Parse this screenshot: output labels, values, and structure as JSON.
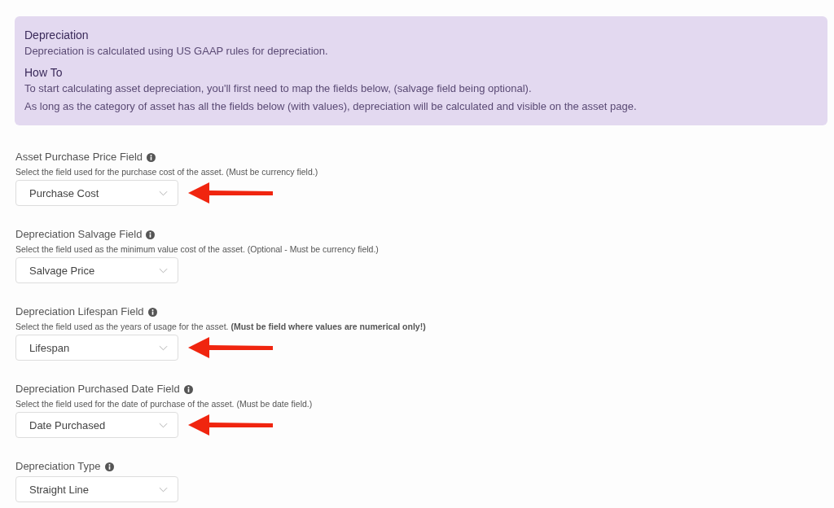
{
  "info_box": {
    "sections": [
      {
        "heading": "Depreciation",
        "lines": [
          "Depreciation is calculated using US GAAP rules for depreciation."
        ]
      },
      {
        "heading": "How To",
        "lines": [
          "To start calculating asset depreciation, you'll first need to map the fields below, (salvage field being optional).",
          "As long as the category of asset has all the fields below (with values), depreciation will be calculated and visible on the asset page."
        ]
      }
    ]
  },
  "fields": [
    {
      "label": "Asset Purchase Price Field",
      "hint": "Select the field used for the purchase cost of the asset. (Must be currency field.)",
      "value": "Purchase Cost",
      "arrow": true
    },
    {
      "label": "Depreciation Salvage Field",
      "hint": "Select the field used as the minimum value cost of the asset. (Optional - Must be currency field.)",
      "value": "Salvage Price",
      "arrow": false
    },
    {
      "label": "Depreciation Lifespan Field",
      "hint": "Select the field used as the years of usage for the asset. **(Must be field where values are numerical only!)**",
      "value": "Lifespan",
      "arrow": true
    },
    {
      "label": "Depreciation Purchased Date Field",
      "hint": "Select the field used for the date of purchase of the asset. (Must be date field.)",
      "value": "Date Purchased",
      "arrow": true
    },
    {
      "label": "Depreciation Type",
      "value": "Straight Line",
      "arrow": false
    }
  ]
}
